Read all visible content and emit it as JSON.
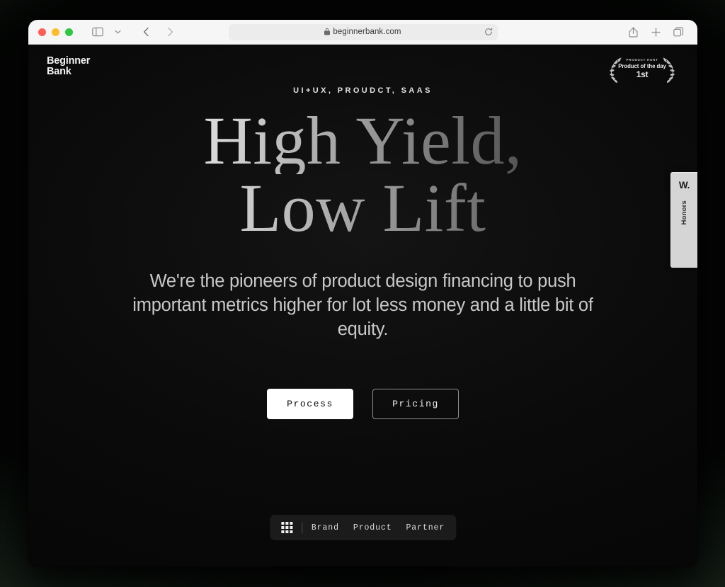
{
  "browser": {
    "url": "beginnerbank.com",
    "lock_icon": "lock-icon",
    "reload_icon": "reload-icon",
    "sidebar_icon": "sidebar-toggle-icon",
    "chevron_icon": "chevron-down-icon",
    "back_icon": "back-chevron-icon",
    "forward_icon": "forward-chevron-icon",
    "share_icon": "share-icon",
    "new_tab_icon": "plus-icon",
    "tab_overview_icon": "tab-overview-icon",
    "traffic_lights": [
      "close",
      "minimize",
      "maximize"
    ]
  },
  "site": {
    "logo_line1": "Beginner",
    "logo_line2": "Bank",
    "badge": {
      "kicker": "PRODUCT HUNT",
      "title": "Product of the day",
      "rank": "1st",
      "laurel_icon": "laurel-wreath-icon"
    },
    "honors_tab": {
      "mark": "W.",
      "label": "Honors"
    },
    "hero": {
      "eyebrow": "UI+UX, PROUDCT, SAAS",
      "headline_line1": "High Yield,",
      "headline_line2": "Low Lift",
      "subhead": "We're the pioneers of product design financing to push important metrics higher for lot less money and a little bit of equity.",
      "cta_primary": "Process",
      "cta_secondary": "Pricing"
    },
    "bottom_nav": {
      "grid_icon": "grid-menu-icon",
      "links": [
        {
          "label": "Brand"
        },
        {
          "label": "Product"
        },
        {
          "label": "Partner"
        }
      ]
    }
  },
  "colors": {
    "page_bg": "#0a0a0a",
    "backdrop_green": "#4c7054",
    "toolbar_bg": "#f6f6f6",
    "accent_white": "#ffffff",
    "honors_tab_bg": "#d5d5d5"
  }
}
